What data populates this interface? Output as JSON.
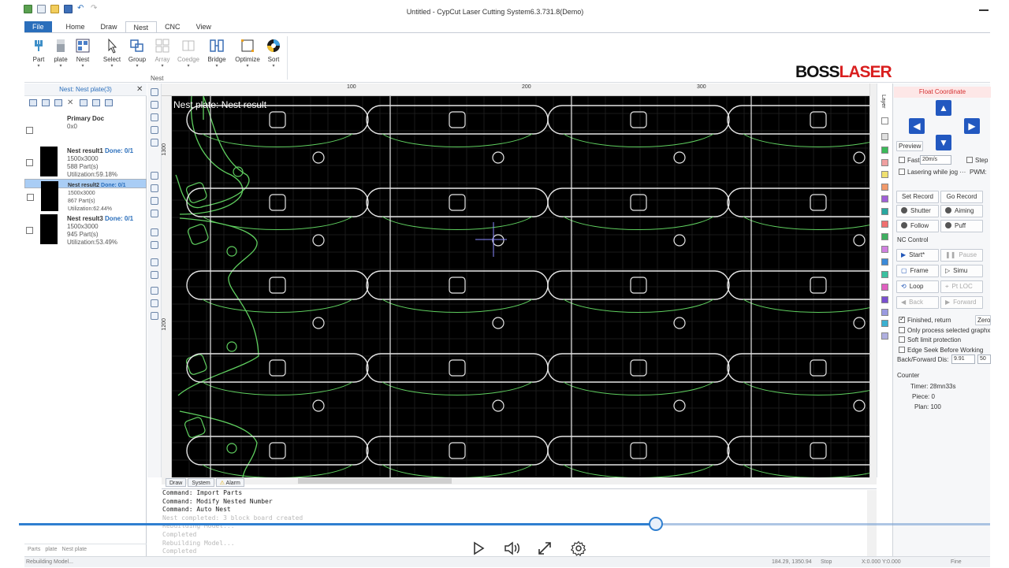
{
  "window": {
    "title": "Untitled - CypCut Laser Cutting System6.3.731.8(Demo)"
  },
  "tabs": [
    "File",
    "Home",
    "Draw",
    "Nest",
    "CNC",
    "View"
  ],
  "ribbon": {
    "buttons": [
      "Part",
      "plate",
      "Nest",
      "Select",
      "Group",
      "Array",
      "Coedge",
      "Bridge",
      "Optimize",
      "Sort"
    ],
    "group_label": "Nest"
  },
  "logo": {
    "part1": "BOSS",
    "part2": "LASER",
    "accent_color": "#d91e1e"
  },
  "left_panel": {
    "header": "Nest: Nest plate(3)",
    "primary": {
      "name": "Primary Doc",
      "info": "0x0"
    },
    "results": [
      {
        "name": "Nest result1",
        "done": "Done: 0/1",
        "size": "1500x3000",
        "parts": "588 Part(s)",
        "util": "Utilization:59.18%"
      },
      {
        "name": "Nest result2",
        "done": "Done: 0/1",
        "size": "1500x3000",
        "parts": "867 Part(s)",
        "util": "Utilization:62.44%"
      },
      {
        "name": "Nest result3",
        "done": "Done: 0/1",
        "size": "1500x3000",
        "parts": "945 Part(s)",
        "util": "Utilization:53.49%"
      }
    ],
    "bottom_tabs": [
      "Parts",
      "plate",
      "Nest plate"
    ]
  },
  "ruler": {
    "top": [
      "100",
      "200",
      "300"
    ],
    "left": [
      "1300",
      "1200"
    ]
  },
  "canvas": {
    "label": "Nest plate: Nest result",
    "line_color": "#5fcf5f",
    "part_color": "#e6e6e6"
  },
  "bottom_tabs": [
    "Draw",
    "System",
    "Alarm"
  ],
  "console": {
    "lines": [
      {
        "t": "Command: Import Parts",
        "faint": false
      },
      {
        "t": "Command: Modify Nested Number",
        "faint": false
      },
      {
        "t": "Command: Auto Nest",
        "faint": false
      },
      {
        "t": "Nest completed: 3 block board created",
        "faint": true
      },
      {
        "t": "Rebuilding Model...",
        "faint": true
      },
      {
        "t": "Completed",
        "faint": true
      },
      {
        "t": "Rebuilding Model...",
        "faint": true
      },
      {
        "t": "Completed",
        "faint": true
      }
    ]
  },
  "layer_label": "Layer",
  "right_panel": {
    "header": "Float Coordinate",
    "preview": "Preview",
    "fast": "Fast",
    "speed": "20m/s",
    "step": "Step",
    "lasering": "Lasering while jog",
    "pwm": "PWM:",
    "set_record": "Set Record",
    "go_record": "Go Record",
    "shutter": "Shutter",
    "aiming": "Aiming",
    "follow": "Follow",
    "puff": "Puff",
    "nc_control": "NC Control",
    "start": "Start*",
    "pause": "Pause",
    "frame": "Frame",
    "simu": "Simu",
    "loop": "Loop",
    "ptloc": "Pt LOC",
    "back": "Back",
    "forward": "Forward",
    "finished": "Finished, return",
    "zero": "Zero",
    "only_sel": "Only process selected graphx",
    "soft_limit": "Soft limit protection",
    "edge_seek": "Edge Seek Before Working",
    "bf_dis": "Back/Forward Dis:",
    "bf_val": "9.91",
    "bf_val2": "50",
    "counter": "Counter",
    "timer": "Timer: 28mn33s",
    "piece": "Piece: 0",
    "plan": "Plan: 100"
  },
  "status": {
    "left": "Rebuilding Model...",
    "coord": "184.29, 1350.94",
    "state": "Stop",
    "xy": "X:0.000 Y:0.000",
    "fine": "Fine"
  },
  "video": {
    "progress": 0.66
  }
}
